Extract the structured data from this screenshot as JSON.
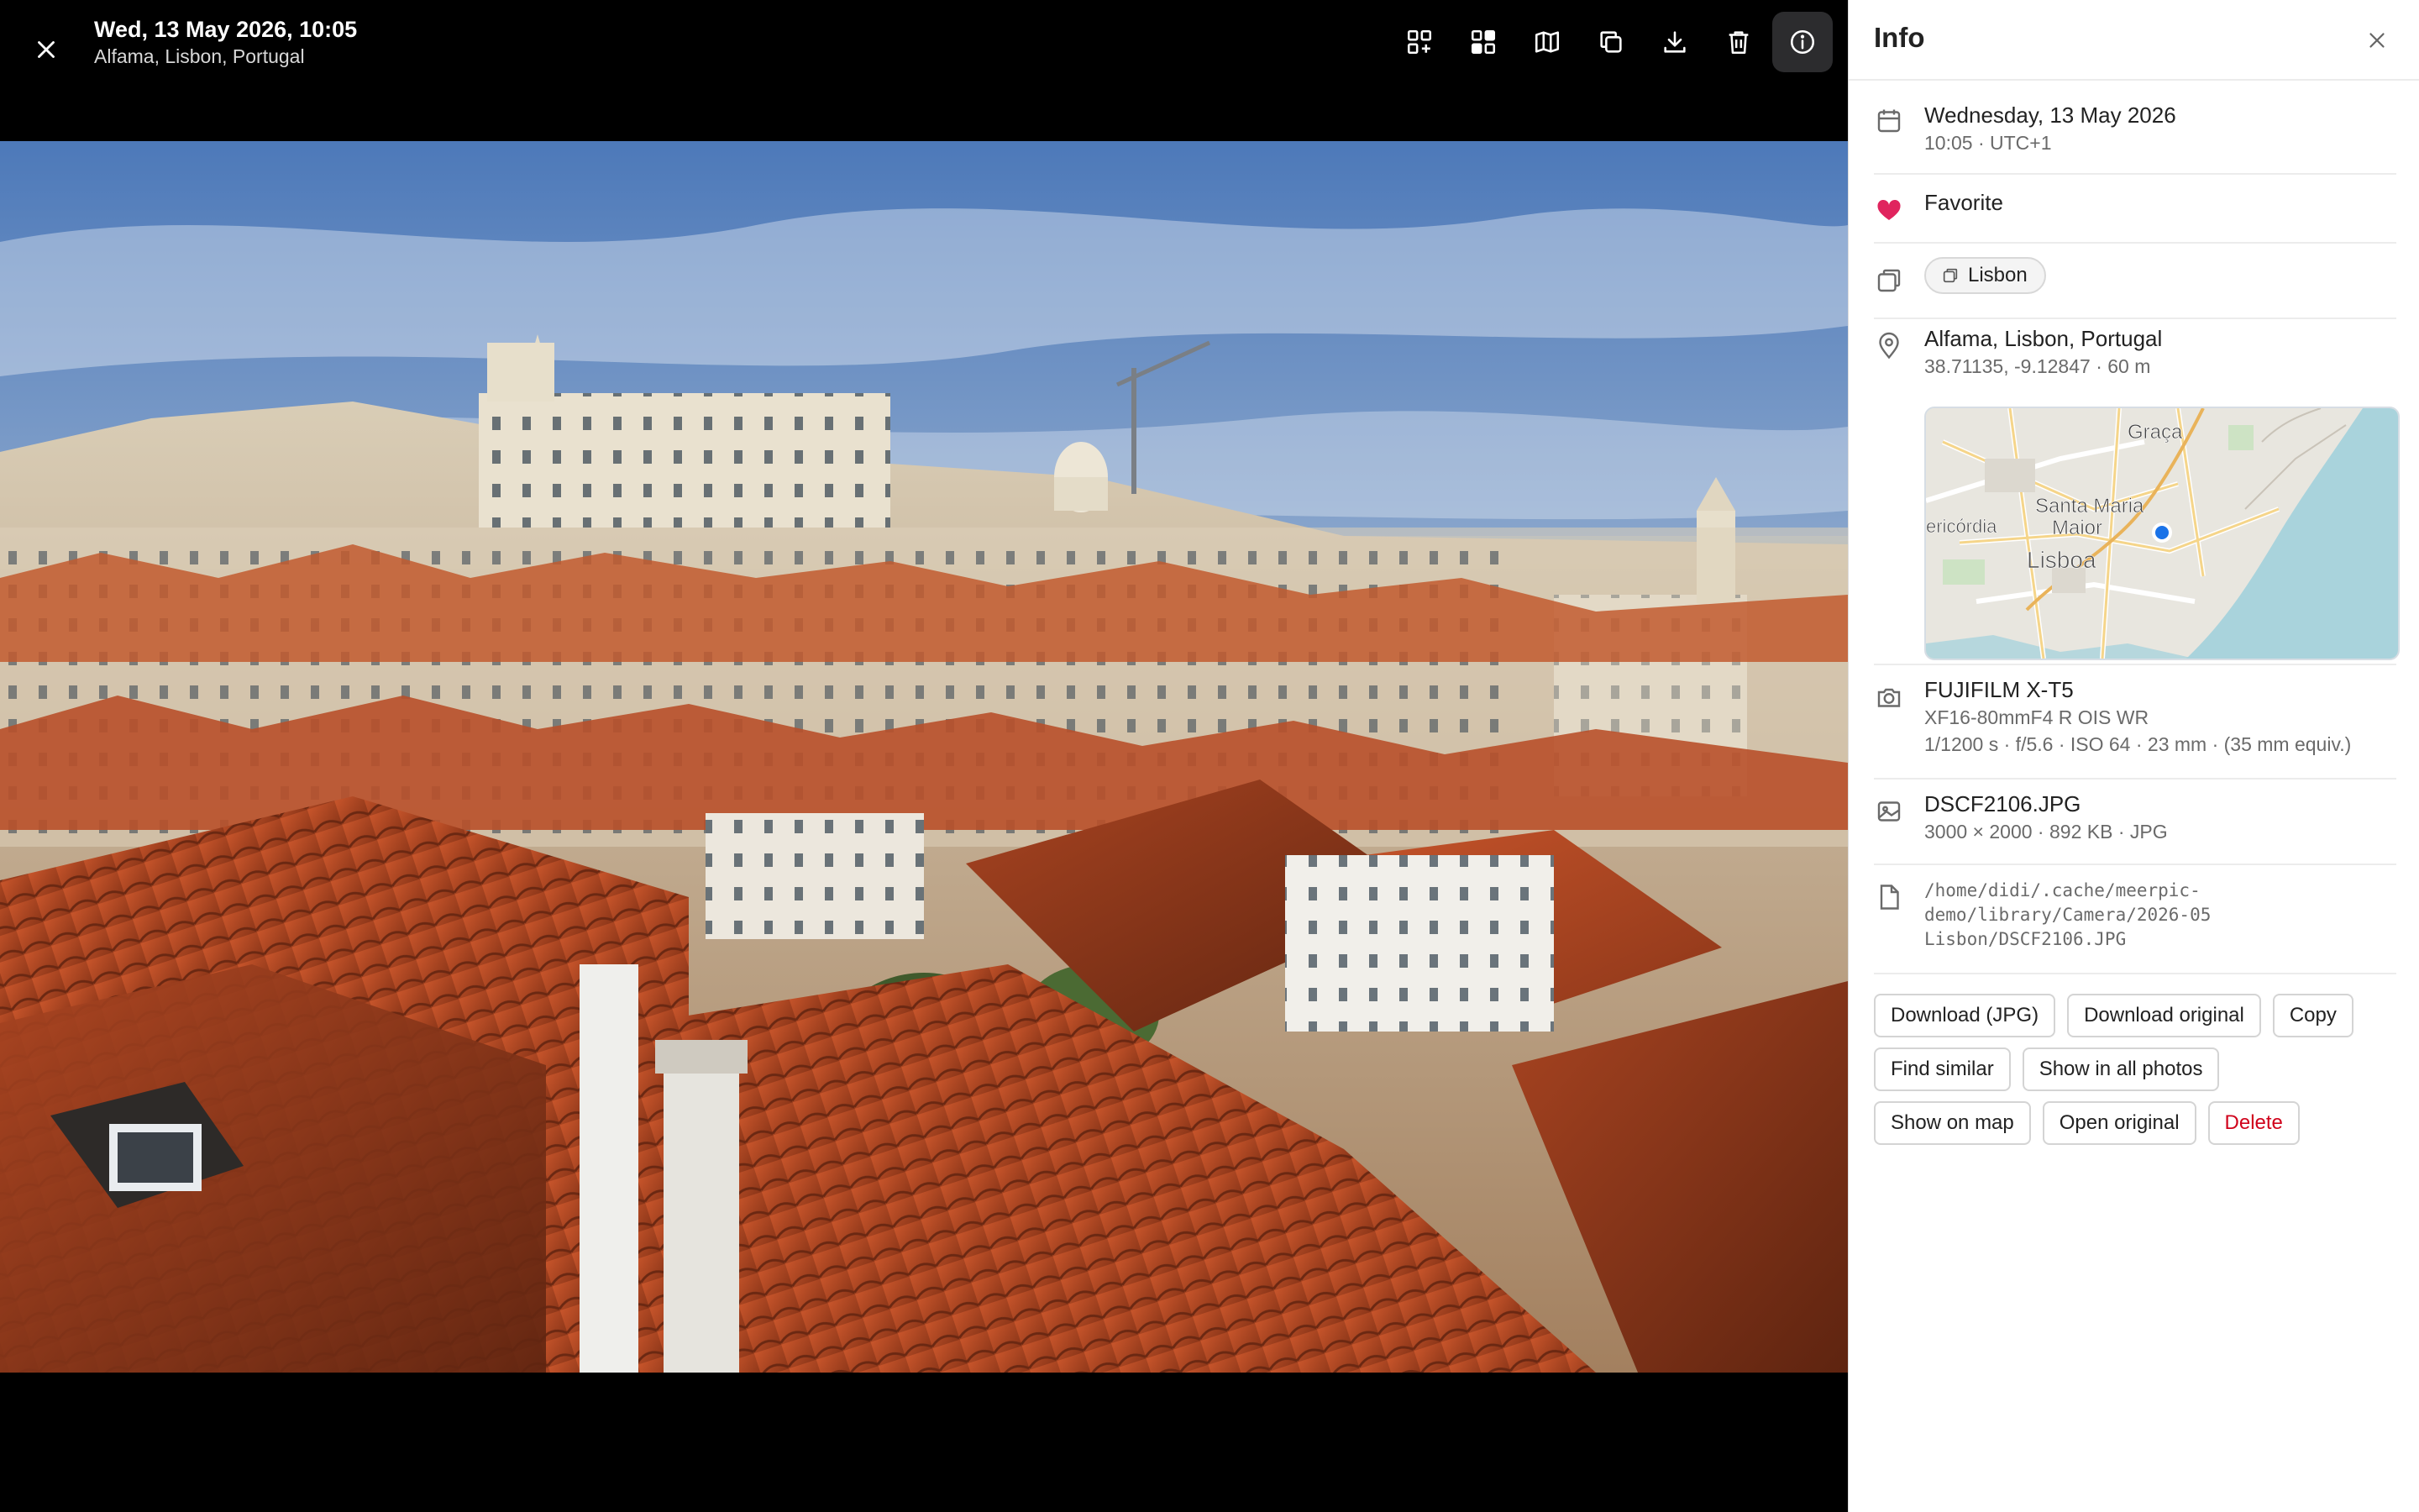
{
  "viewer": {
    "title": "Wed, 13 May 2026, 10:05",
    "subtitle": "Alfama, Lisbon, Portugal",
    "tools": [
      {
        "name": "select-similar-icon"
      },
      {
        "name": "collage-icon"
      },
      {
        "name": "map-icon"
      },
      {
        "name": "duplicate-icon"
      },
      {
        "name": "download-icon"
      },
      {
        "name": "trash-icon"
      },
      {
        "name": "info-icon",
        "active": true
      }
    ]
  },
  "panel": {
    "title": "Info",
    "date": {
      "primary": "Wednesday, 13 May 2026",
      "secondary": "10:05 · UTC+1"
    },
    "favorite": {
      "label": "Favorite",
      "color": "#e0245e"
    },
    "album": {
      "label": "Lisbon"
    },
    "location": {
      "primary": "Alfama, Lisbon, Portugal",
      "secondary": "38.71135, -9.12847 · 60 m",
      "map_labels": {
        "graca": "Graça",
        "santa_maria": "Santa Maria",
        "maior": "Maior",
        "misericordia": "ericórdia",
        "lisboa": "Lisboa"
      }
    },
    "camera": {
      "primary": "FUJIFILM X-T5",
      "lens": "XF16-80mmF4 R OIS WR",
      "exposure": "1/1200 s · f/5.6 · ISO 64 · 23 mm · (35 mm equiv.)"
    },
    "file": {
      "primary": "DSCF2106.JPG",
      "secondary": "3000 × 2000 · 892 KB · JPG"
    },
    "path": {
      "line1": "/home/didi/.cache/meerpic-",
      "line2": "demo/library/Camera/2026-05",
      "line3": "Lisbon/DSCF2106.JPG"
    },
    "actions": {
      "download_jpg": "Download (JPG)",
      "download_original": "Download original",
      "copy": "Copy",
      "find_similar": "Find similar",
      "show_all": "Show in all photos",
      "show_map": "Show on map",
      "open_original": "Open original",
      "delete": "Delete"
    }
  },
  "colors": {
    "accent_blue": "#1a73e8",
    "danger": "#d0021b",
    "favorite": "#e0245e"
  }
}
